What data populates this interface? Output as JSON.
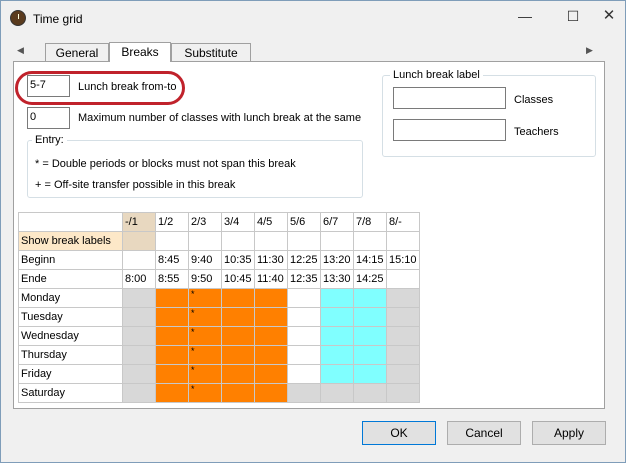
{
  "window": {
    "title": "Time grid"
  },
  "tabs": [
    "General",
    "Breaks",
    "Substitute"
  ],
  "lunch": {
    "value": "5-7",
    "label": "Lunch break from-to",
    "max_value": "0",
    "max_label": "Maximum number of classes with lunch break at the same"
  },
  "lunch_label_group": {
    "title": "Lunch break label",
    "classes_label": "Classes",
    "teachers_label": "Teachers",
    "classes_value": "",
    "teachers_value": ""
  },
  "entry_group": {
    "title": "Entry:",
    "line1": "* = Double periods or blocks must not span this break",
    "line2": "+ = Off-site transfer possible in this break"
  },
  "grid": {
    "columns": [
      "-/1",
      "1/2",
      "2/3",
      "3/4",
      "4/5",
      "5/6",
      "6/7",
      "7/8",
      "8/-"
    ],
    "show_labels": "Show break labels",
    "beginn_label": "Beginn",
    "beginn": [
      "",
      "8:45",
      "9:40",
      "10:35",
      "11:30",
      "12:25",
      "13:20",
      "14:15",
      "15:10"
    ],
    "ende_label": "Ende",
    "ende": [
      "8:00",
      "8:55",
      "9:50",
      "10:45",
      "11:40",
      "12:35",
      "13:30",
      "14:25",
      ""
    ],
    "days": [
      {
        "name": "Monday",
        "marks": [
          "",
          "",
          "*",
          "",
          "",
          "",
          "",
          "",
          ""
        ]
      },
      {
        "name": "Tuesday",
        "marks": [
          "",
          "",
          "*",
          "",
          "",
          "",
          "",
          "",
          ""
        ]
      },
      {
        "name": "Wednesday",
        "marks": [
          "",
          "",
          "*",
          "",
          "",
          "",
          "",
          "",
          ""
        ]
      },
      {
        "name": "Thursday",
        "marks": [
          "",
          "",
          "*",
          "",
          "",
          "",
          "",
          "",
          ""
        ]
      },
      {
        "name": "Friday",
        "marks": [
          "",
          "",
          "*",
          "",
          "",
          "",
          "",
          "",
          ""
        ]
      },
      {
        "name": "Saturday",
        "marks": [
          "",
          "",
          "*",
          "",
          "",
          "",
          "",
          "",
          ""
        ]
      }
    ]
  },
  "buttons": {
    "ok": "OK",
    "cancel": "Cancel",
    "apply": "Apply"
  },
  "colors": {
    "orange": "#ff8000",
    "cyan": "#80ffff",
    "highlight": "#c0222b"
  }
}
